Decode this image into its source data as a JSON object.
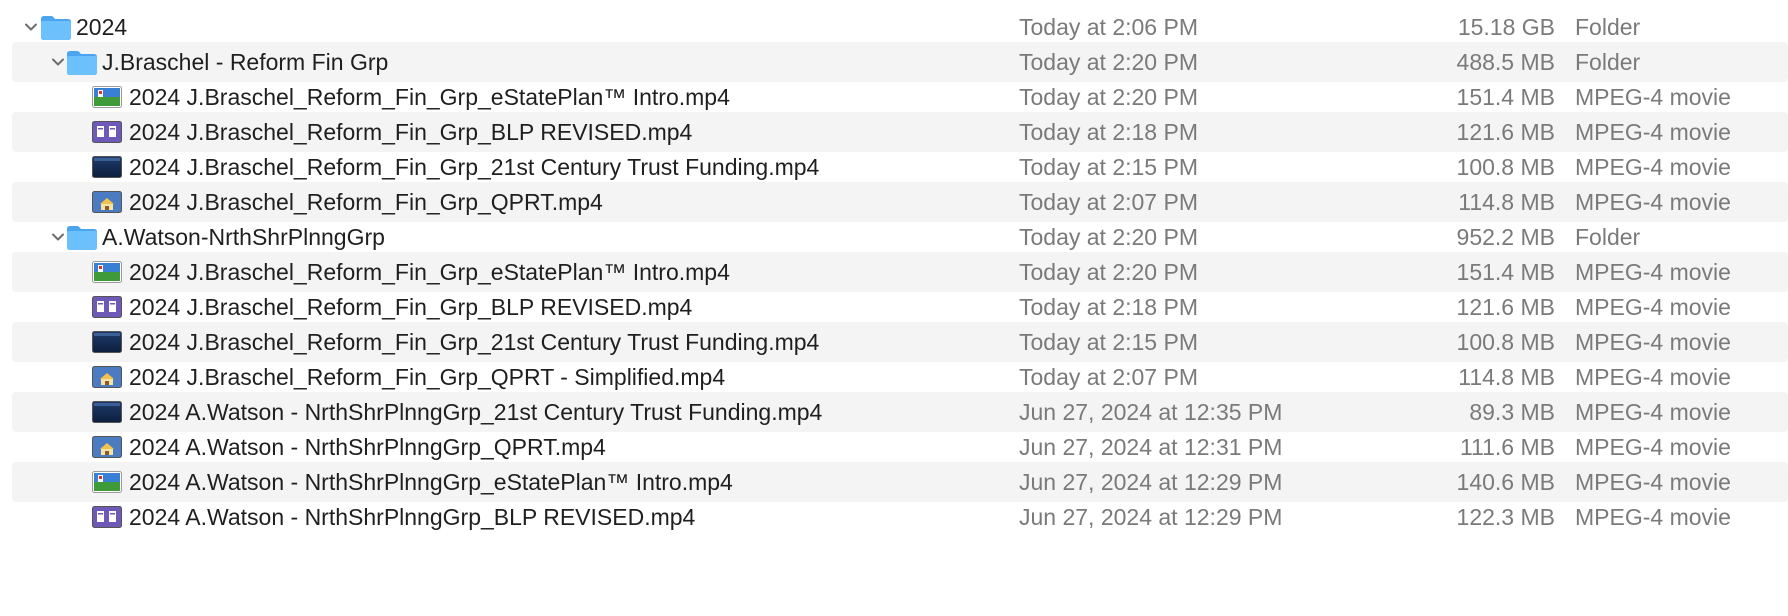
{
  "colors": {
    "folder_blue": "#5ab4f5",
    "row_alternate": "#f4f4f4",
    "secondary_text": "#7a7a7a"
  },
  "rows": [
    {
      "name": "2024",
      "date": "Today at 2:06 PM",
      "size": "15.18 GB",
      "kind": "Folder",
      "type": "folder",
      "level": 0,
      "expanded": true,
      "icon": "folder-icon"
    },
    {
      "name": "J.Braschel - Reform Fin Grp",
      "date": "Today at 2:20 PM",
      "size": "488.5 MB",
      "kind": "Folder",
      "type": "folder",
      "level": 1,
      "expanded": true,
      "icon": "folder-icon"
    },
    {
      "name": "2024 J.Braschel_Reform_Fin_Grp_eStatePlan™ Intro.mp4",
      "date": "Today at 2:20 PM",
      "size": "151.4 MB",
      "kind": "MPEG-4 movie",
      "type": "file",
      "level": 2,
      "icon": "landscape-thumbnail-icon"
    },
    {
      "name": "2024 J.Braschel_Reform_Fin_Grp_BLP REVISED.mp4",
      "date": "Today at 2:18 PM",
      "size": "121.6 MB",
      "kind": "MPEG-4 movie",
      "type": "file",
      "level": 2,
      "icon": "purple-slides-thumbnail-icon"
    },
    {
      "name": "2024 J.Braschel_Reform_Fin_Grp_21st Century Trust Funding.mp4",
      "date": "Today at 2:15 PM",
      "size": "100.8 MB",
      "kind": "MPEG-4 movie",
      "type": "file",
      "level": 2,
      "icon": "dark-blue-thumbnail-icon"
    },
    {
      "name": "2024 J.Braschel_Reform_Fin_Grp_QPRT.mp4",
      "date": "Today at 2:07 PM",
      "size": "114.8 MB",
      "kind": "MPEG-4 movie",
      "type": "file",
      "level": 2,
      "icon": "house-thumbnail-icon"
    },
    {
      "name": "A.Watson-NrthShrPlnngGrp",
      "date": "Today at 2:20 PM",
      "size": "952.2 MB",
      "kind": "Folder",
      "type": "folder",
      "level": 1,
      "expanded": true,
      "icon": "folder-icon"
    },
    {
      "name": "2024 J.Braschel_Reform_Fin_Grp_eStatePlan™ Intro.mp4",
      "date": "Today at 2:20 PM",
      "size": "151.4 MB",
      "kind": "MPEG-4 movie",
      "type": "file",
      "level": 2,
      "icon": "landscape-thumbnail-icon"
    },
    {
      "name": "2024 J.Braschel_Reform_Fin_Grp_BLP REVISED.mp4",
      "date": "Today at 2:18 PM",
      "size": "121.6 MB",
      "kind": "MPEG-4 movie",
      "type": "file",
      "level": 2,
      "icon": "purple-slides-thumbnail-icon"
    },
    {
      "name": "2024 J.Braschel_Reform_Fin_Grp_21st Century Trust Funding.mp4",
      "date": "Today at 2:15 PM",
      "size": "100.8 MB",
      "kind": "MPEG-4 movie",
      "type": "file",
      "level": 2,
      "icon": "dark-blue-thumbnail-icon"
    },
    {
      "name": "2024 J.Braschel_Reform_Fin_Grp_QPRT - Simplified.mp4",
      "date": "Today at 2:07 PM",
      "size": "114.8 MB",
      "kind": "MPEG-4 movie",
      "type": "file",
      "level": 2,
      "icon": "house-thumbnail-icon"
    },
    {
      "name": "2024 A.Watson - NrthShrPlnngGrp_21st Century Trust Funding.mp4",
      "date": "Jun 27, 2024 at 12:35 PM",
      "size": "89.3 MB",
      "kind": "MPEG-4 movie",
      "type": "file",
      "level": 2,
      "icon": "dark-blue-thumbnail-icon"
    },
    {
      "name": "2024 A.Watson - NrthShrPlnngGrp_QPRT.mp4",
      "date": "Jun 27, 2024 at 12:31 PM",
      "size": "111.6 MB",
      "kind": "MPEG-4 movie",
      "type": "file",
      "level": 2,
      "icon": "house-thumbnail-icon"
    },
    {
      "name": "2024 A.Watson - NrthShrPlnngGrp_eStatePlan™ Intro.mp4",
      "date": "Jun 27, 2024 at 12:29 PM",
      "size": "140.6 MB",
      "kind": "MPEG-4 movie",
      "type": "file",
      "level": 2,
      "icon": "landscape-thumbnail-icon"
    },
    {
      "name": "2024 A.Watson - NrthShrPlnngGrp_BLP REVISED.mp4",
      "date": "Jun 27, 2024 at 12:29 PM",
      "size": "122.3 MB",
      "kind": "MPEG-4 movie",
      "type": "file",
      "level": 2,
      "icon": "purple-slides-thumbnail-icon"
    }
  ]
}
